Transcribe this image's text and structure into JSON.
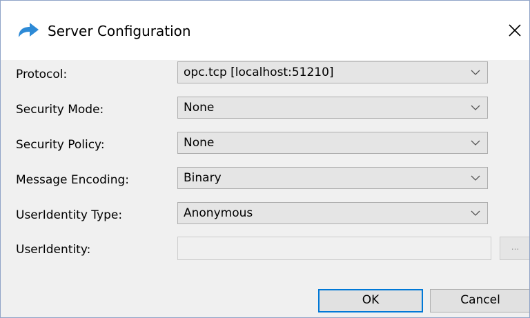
{
  "window": {
    "title": "Server Configuration",
    "icon": "arrow-share-icon",
    "accent_color": "#0078d7"
  },
  "form": {
    "rows": [
      {
        "label": "Protocol:",
        "value": "opc.tcp [localhost:51210]"
      },
      {
        "label": "Security Mode:",
        "value": "None"
      },
      {
        "label": "Security Policy:",
        "value": "None"
      },
      {
        "label": "Message Encoding:",
        "value": "Binary"
      },
      {
        "label": "UserIdentity Type:",
        "value": "Anonymous"
      }
    ],
    "user_identity": {
      "label": "UserIdentity:",
      "value": "",
      "browse_label": "..."
    }
  },
  "buttons": {
    "ok": "OK",
    "cancel": "Cancel"
  }
}
